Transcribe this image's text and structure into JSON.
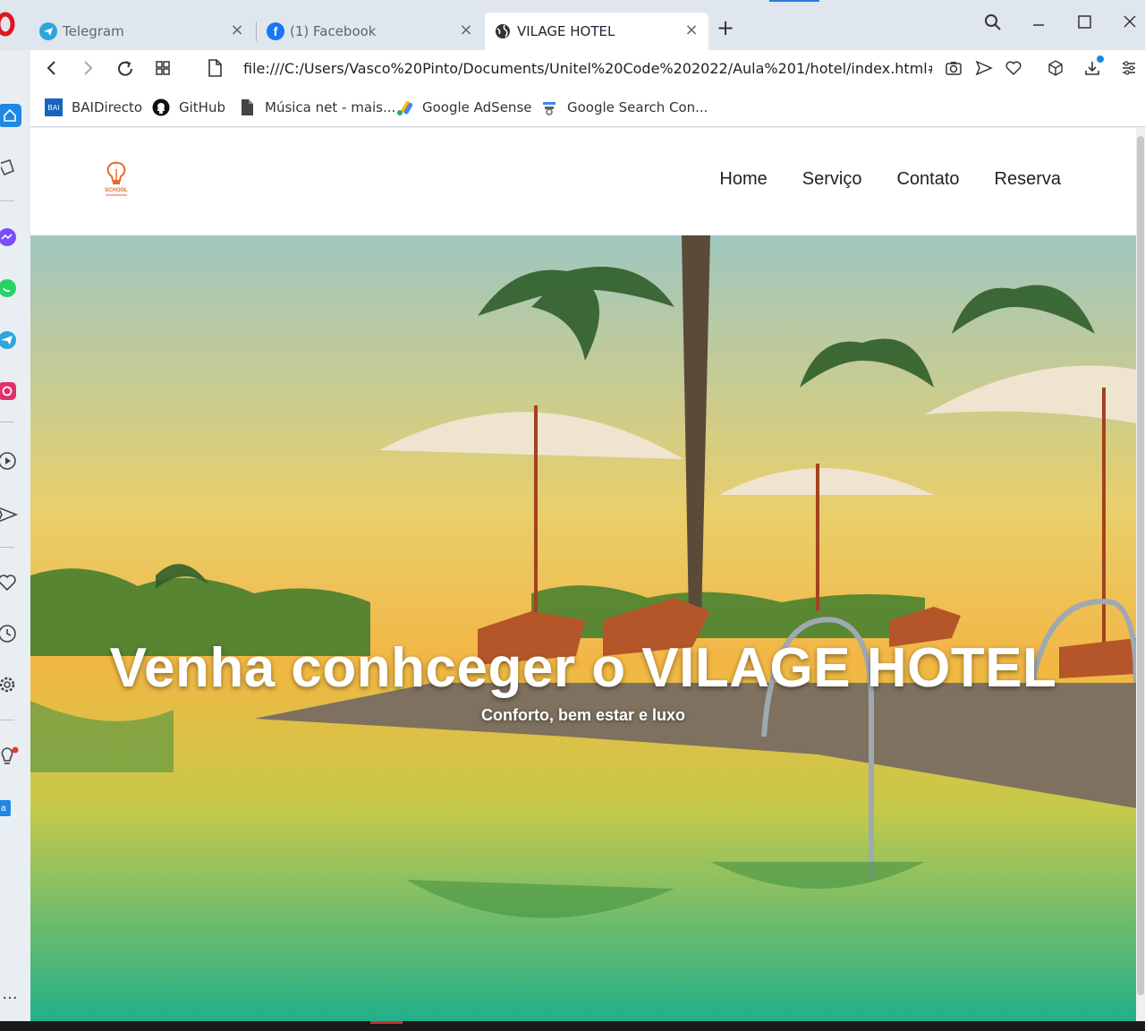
{
  "browser": {
    "tabs": [
      {
        "label": "Telegram",
        "icon": "telegram-icon",
        "active": false
      },
      {
        "label": "(1) Facebook",
        "icon": "facebook-icon",
        "active": false
      },
      {
        "label": "VILAGE HOTEL",
        "icon": "globe-icon",
        "active": true
      }
    ],
    "url": "file:///C:/Users/Vasco%20Pinto/Documents/Unitel%20Code%202022/Aula%201/hotel/index.html#",
    "bookmarks": [
      {
        "label": "BAIDirecto",
        "icon": "bai-icon"
      },
      {
        "label": "GitHub",
        "icon": "github-icon"
      },
      {
        "label": "Música net - mais...",
        "icon": "file-icon"
      },
      {
        "label": "Google AdSense",
        "icon": "adsense-icon"
      },
      {
        "label": "Google Search Con...",
        "icon": "search-console-icon"
      }
    ],
    "bai_badge": "BAI",
    "colors": {
      "accent": "#2a7ae2",
      "opera_red": "#e0161e",
      "tab_bar": "#dfe6ee"
    }
  },
  "site": {
    "logo_text": "SCHOOL",
    "nav": [
      "Home",
      "Serviço",
      "Contato",
      "Reserva"
    ],
    "hero": {
      "title": "Venha conhceger o VILAGE HOTEL",
      "subtitle": "Conforto, bem estar e luxo"
    }
  }
}
